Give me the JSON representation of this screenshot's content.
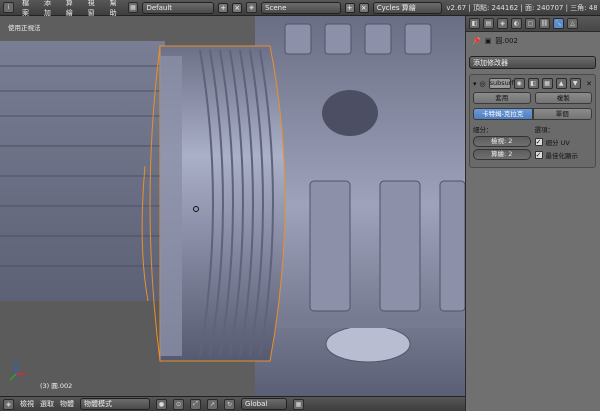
{
  "topbar": {
    "menus": [
      "檔案",
      "添加",
      "算繪",
      "視窗",
      "幫助"
    ],
    "layout_value": "Default",
    "scene_value": "Scene",
    "engine_value": "Cycles 算繪",
    "stats": "v2.67 | 頂點: 244162 | 面: 240707 | 三角: 48"
  },
  "viewport": {
    "view_label": "使用正視法",
    "object_label": "(3) 圓.002"
  },
  "properties": {
    "object_name": "圓.002",
    "add_modifier_label": "添加修改器",
    "modifier_type_icon": "subsurf",
    "apply_label": "套用",
    "copy_label": "複製",
    "mode_catmull": "卡特姆-克拉克",
    "mode_simple": "單個",
    "subdivisions_label": "細分：",
    "view_levels": "檢視: 2",
    "render_levels": "算繪: 2",
    "options_label": "選項：",
    "subdivide_uv_label": "細分 UV",
    "optimal_display_label": "最佳化顯示"
  },
  "bottombar": {
    "items": [
      "檢視",
      "選取",
      "物體"
    ],
    "mode_value": "物體模式",
    "orientation_value": "Global"
  },
  "colors": {
    "mesh": "#8a8ea6",
    "selection": "#e8902a",
    "accent": "#5a8ad0"
  }
}
